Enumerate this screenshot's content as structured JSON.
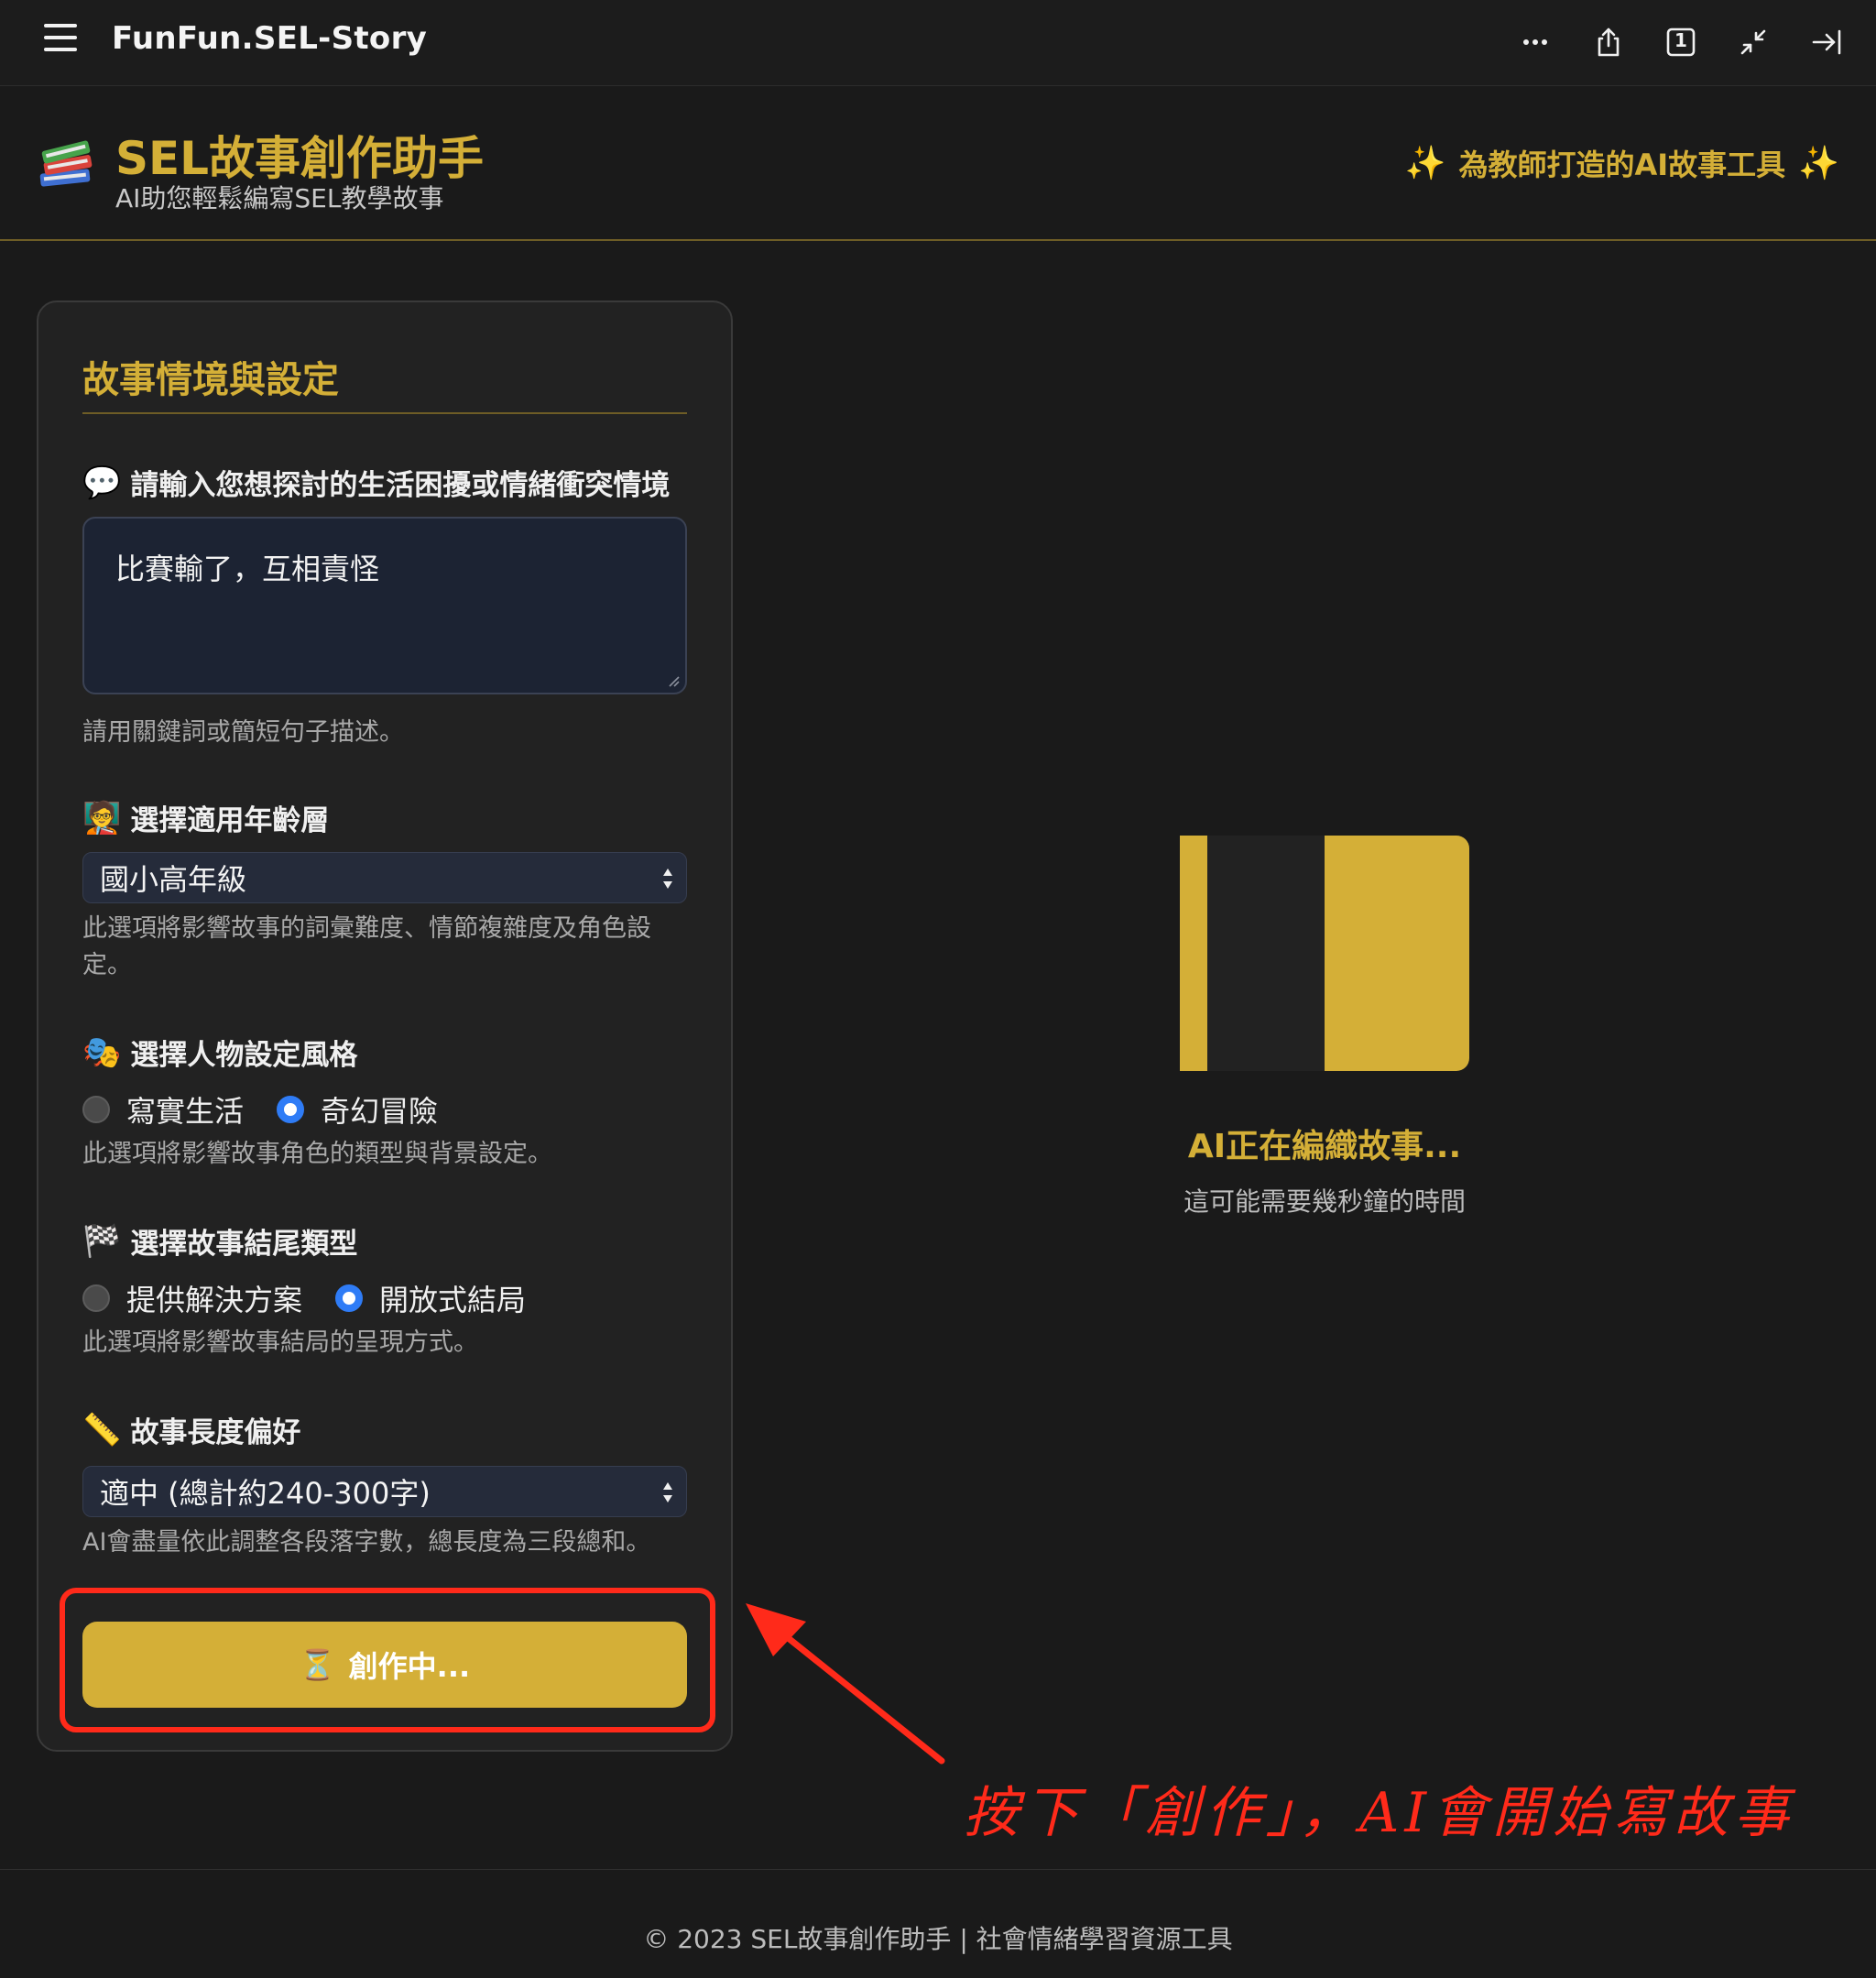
{
  "topbar": {
    "app_title": "FunFun.SEL-Story",
    "icons": [
      "hamburger-menu-icon",
      "more-icon",
      "share-icon",
      "tab-count-icon",
      "minimize-icon",
      "collapse-sidebar-icon"
    ],
    "tab_count": "1"
  },
  "header": {
    "icon": "books-icon",
    "title": "SEL故事創作助手",
    "subtitle": "AI助您輕鬆編寫SEL教學故事",
    "tagline": "為教師打造的AI故事工具",
    "sparkle_left": "✨",
    "sparkle_right": "✨"
  },
  "form": {
    "title": "故事情境與設定",
    "situation": {
      "emoji": "💬",
      "label": "請輸入您想探討的生活困擾或情緒衝突情境",
      "value": "比賽輸了，互相責怪",
      "hint": "請用關鍵詞或簡短句子描述。"
    },
    "age": {
      "emoji": "🧑‍🏫",
      "label": "選擇適用年齡層",
      "selected": "國小高年級",
      "hint": "此選項將影響故事的詞彙難度、情節複雜度及角色設定。"
    },
    "character_style": {
      "emoji": "🎭",
      "label": "選擇人物設定風格",
      "options": [
        "寫實生活",
        "奇幻冒險"
      ],
      "selected": "奇幻冒險",
      "hint": "此選項將影響故事角色的類型與背景設定。"
    },
    "ending": {
      "emoji": "🏁",
      "label": "選擇故事結尾類型",
      "options": [
        "提供解決方案",
        "開放式結局"
      ],
      "selected": "開放式結局",
      "hint": "此選項將影響故事結局的呈現方式。"
    },
    "length": {
      "emoji": "📏",
      "label": "故事長度偏好",
      "selected": "適中 (總計約240-300字)",
      "hint": "AI會盡量依此調整各段落字數，總長度為三段總和。"
    },
    "submit": {
      "emoji": "⏳",
      "label": "創作中..."
    }
  },
  "loading": {
    "title": "AI正在編織故事...",
    "subtitle": "這可能需要幾秒鐘的時間",
    "colors": {
      "gold": "#d4af37",
      "dark": "#222222"
    }
  },
  "annotation": {
    "text": "按下「創作」，AI會開始寫故事",
    "color": "#ff2a1a"
  },
  "footer": {
    "line1": "© 2023 SEL故事創作助手 | 社會情緒學習資源工具"
  },
  "colors": {
    "accent": "#d4af37",
    "background": "#1a1a1a",
    "panel": "#222222",
    "radio_selected": "#2f7cf6"
  }
}
